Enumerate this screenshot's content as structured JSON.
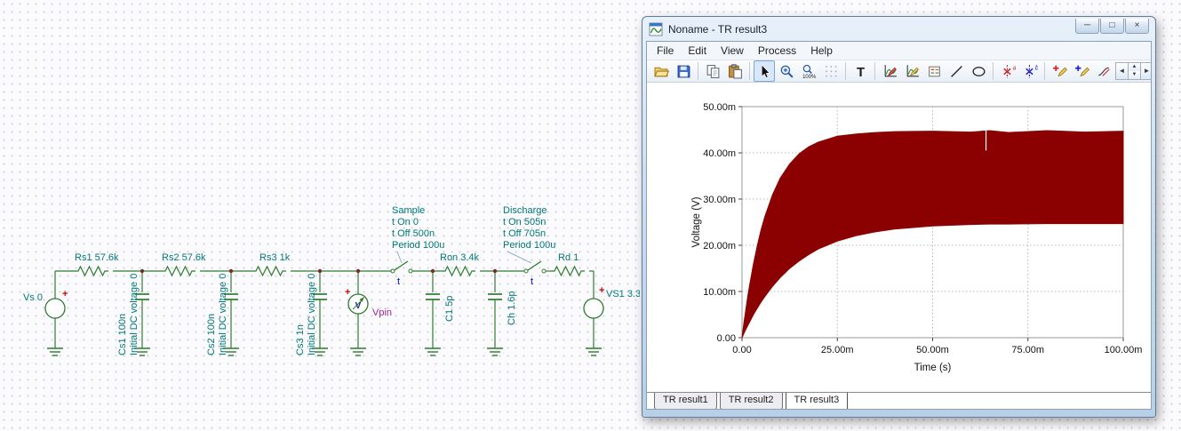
{
  "schematic": {
    "labels": {
      "vs": "Vs 0",
      "rs1": "Rs1 57.6k",
      "rs2": "Rs2 57.6k",
      "rs3": "Rs3 1k",
      "cs1": "Cs1 100n",
      "cs1_init": "Initial DC voltage 0",
      "cs2": "Cs2 100n",
      "cs2_init": "Initial DC voltage 0",
      "cs3": "Cs3 1n",
      "cs3_init": "Initial DC voltage 0",
      "vpin": "Vpin",
      "meter_v": "V",
      "sample_title": "Sample",
      "sample_t_on": "t On 0",
      "sample_t_off": "t Off 500n",
      "sample_period": "Period 100u",
      "ron": "Ron 3.4k",
      "c1": "C1 5p",
      "ch": "Ch 1.6p",
      "discharge_title": "Discharge",
      "discharge_t_on": "t On 505n",
      "discharge_t_off": "t Off 705n",
      "discharge_period": "Period 100u",
      "rd": "Rd 1",
      "vs1": "VS1 3.3",
      "switch_t": "t",
      "plus": "+"
    },
    "colors": {
      "wire": "#2e7d2e",
      "label": "#007878",
      "blue": "#0000dd",
      "purple": "#a020a0",
      "plus": "#cc0000",
      "meter": "#1b2f8a",
      "node": "#7c2a2a"
    }
  },
  "window": {
    "title": "Noname - TR result3",
    "caption_buttons": [
      {
        "name": "minimize-button",
        "glyph": "─"
      },
      {
        "name": "maximize-button",
        "glyph": "□"
      },
      {
        "name": "close-button",
        "glyph": "×"
      }
    ],
    "menu": [
      "File",
      "Edit",
      "View",
      "Process",
      "Help"
    ],
    "toolbar": [
      {
        "icon": "open-folder"
      },
      {
        "icon": "save"
      },
      {
        "sep": true
      },
      {
        "icon": "copy"
      },
      {
        "icon": "paste"
      },
      {
        "sep": true
      },
      {
        "icon": "cursor",
        "active": true
      },
      {
        "icon": "zoom-in"
      },
      {
        "icon": "zoom-100"
      },
      {
        "icon": "select-grid"
      },
      {
        "sep": true
      },
      {
        "icon": "text-tool"
      },
      {
        "sep": true
      },
      {
        "icon": "axes-edit"
      },
      {
        "icon": "axes-auto"
      },
      {
        "icon": "legend"
      },
      {
        "icon": "line-tool"
      },
      {
        "icon": "ellipse-tool"
      },
      {
        "sep": true
      },
      {
        "icon": "cursor-a"
      },
      {
        "icon": "cursor-b"
      },
      {
        "sep": true
      },
      {
        "icon": "marker-add"
      },
      {
        "icon": "annotate-pencil"
      },
      {
        "icon": "slope-tool"
      }
    ],
    "toolbar_right": {
      "scroll_left": "◄",
      "spin_up": "▲",
      "spin_down": "▼",
      "scroll_right": "►"
    },
    "tabs": [
      "TR result1",
      "TR result2",
      "TR result3"
    ],
    "active_tab": "TR result3"
  },
  "chart_data": {
    "type": "area",
    "title": "",
    "xlabel": "Time (s)",
    "ylabel": "Voltage (V)",
    "xlim": [
      0,
      0.1
    ],
    "ylim": [
      0,
      0.05
    ],
    "grid": true,
    "legend": "none",
    "fill_color": "#8b0000",
    "x_ticks": [
      {
        "v": 0,
        "label": "0.00"
      },
      {
        "v": 0.025,
        "label": "25.00m"
      },
      {
        "v": 0.05,
        "label": "50.00m"
      },
      {
        "v": 0.075,
        "label": "75.00m"
      },
      {
        "v": 0.1,
        "label": "100.00m"
      }
    ],
    "y_ticks": [
      {
        "v": 0,
        "label": "0.00"
      },
      {
        "v": 0.01,
        "label": "10.00m"
      },
      {
        "v": 0.02,
        "label": "20.00m"
      },
      {
        "v": 0.03,
        "label": "30.00m"
      },
      {
        "v": 0.04,
        "label": "40.00m"
      },
      {
        "v": 0.05,
        "label": "50.00m"
      }
    ],
    "series_note": "dense oscillating transient rendered as solid band between charging envelopes",
    "x_s": [
      0,
      0.0005,
      0.001,
      0.0015,
      0.002,
      0.003,
      0.004,
      0.005,
      0.006,
      0.008,
      0.01,
      0.0125,
      0.015,
      0.0175,
      0.02,
      0.025,
      0.03,
      0.035,
      0.04,
      0.05,
      0.06,
      0.065,
      0.07,
      0.08,
      0.09,
      0.1
    ],
    "upper_v": [
      0,
      0.0032,
      0.0061,
      0.0089,
      0.0114,
      0.016,
      0.0199,
      0.0233,
      0.0262,
      0.0309,
      0.0345,
      0.0376,
      0.0398,
      0.0413,
      0.0423,
      0.0436,
      0.0441,
      0.0444,
      0.0446,
      0.0447,
      0.0445,
      0.0448,
      0.0444,
      0.0448,
      0.0445,
      0.0447
    ],
    "lower_v": [
      0,
      0.0009,
      0.0018,
      0.0026,
      0.0034,
      0.005,
      0.0064,
      0.0077,
      0.0089,
      0.0111,
      0.013,
      0.015,
      0.0166,
      0.018,
      0.0192,
      0.0209,
      0.0221,
      0.0229,
      0.0235,
      0.0242,
      0.0245,
      0.0246,
      0.0246,
      0.0247,
      0.0247,
      0.0247
    ],
    "artifact": {
      "x": 0.064,
      "from_v": 0.0405,
      "to_v": 0.0448
    }
  }
}
